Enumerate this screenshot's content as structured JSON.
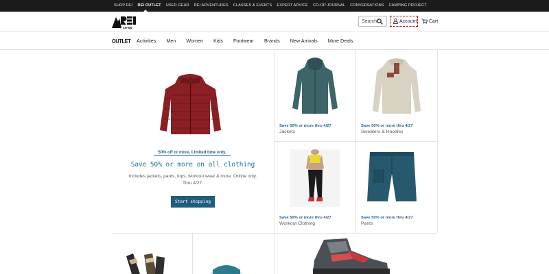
{
  "topbar": {
    "items": [
      "SHOP REI",
      "REI OUTLET",
      "USED GEAR",
      "REI ADVENTURES",
      "CLASSES & EVENTS",
      "EXPERT ADVICE",
      "CO-OP JOURNAL",
      "CONVERSATIONS",
      "CAMPING PROJECT"
    ],
    "active": "REI OUTLET"
  },
  "header": {
    "logo_text": "REI co-op",
    "search_label": "Search",
    "account_label": "Account",
    "cart_label": "Cart"
  },
  "nav": {
    "outlet_label": "OUTLET",
    "items": [
      "Activities",
      "Men",
      "Women",
      "Kids",
      "Footwear",
      "Brands",
      "New Arrivals",
      "More Deals"
    ]
  },
  "hero": {
    "tag": "50% off or more. Limited time only.",
    "title": "Save 50% or more on all clothing",
    "body": "Includes jackets, pants, tops, workout wear & more. Online only. Thru 4/27.",
    "button": "Start shopping"
  },
  "tiles": [
    {
      "promo": "Save 50% or more thru 4/27",
      "name": "Jackets",
      "icon": "teal-hooded-jacket-image"
    },
    {
      "promo": "Save 50% or more thru 4/27",
      "name": "Sweaters & Hoodies",
      "icon": "fleece-pullover-image"
    },
    {
      "promo": "Save 50% or more thru 4/27",
      "name": "Workout Clothing",
      "icon": "workout-model-image"
    },
    {
      "promo": "Save 50% or more thru 4/27",
      "name": "Pants",
      "icon": "teal-shorts-image"
    }
  ],
  "colors": {
    "topbar_bg": "#1b1b1b",
    "promo_blue": "#1d5e8f",
    "headline_blue": "#1d6fa6",
    "button_bg": "#1f5d7c"
  }
}
